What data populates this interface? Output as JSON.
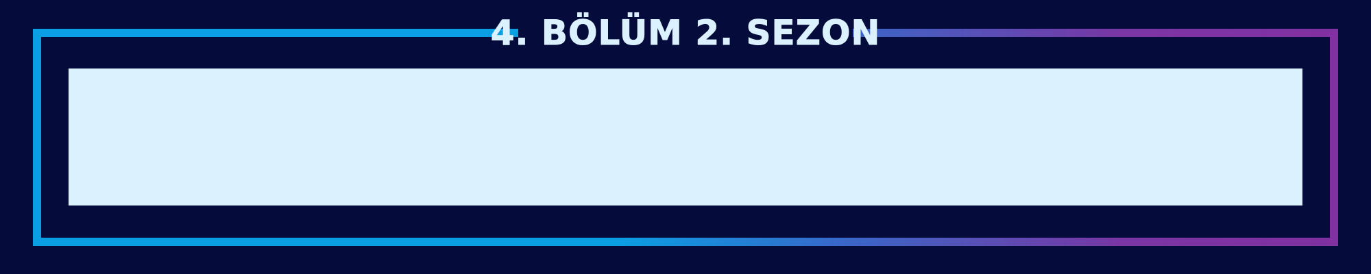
{
  "banner": {
    "title": "4. BÖLÜM 2. SEZON"
  },
  "colors": {
    "background": "#050b3b",
    "frame_start": "#0a9fe2",
    "frame_end": "#8230a0",
    "panel": "#dbf1fe",
    "title_text": "#dbf1fe"
  }
}
